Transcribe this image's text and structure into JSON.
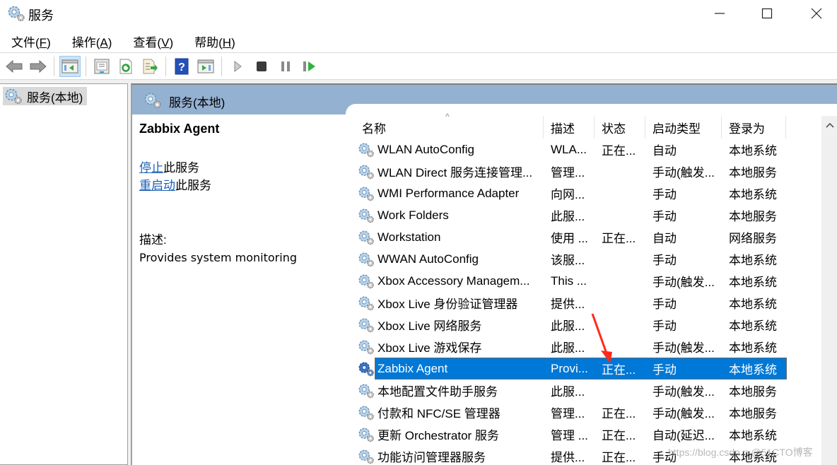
{
  "window": {
    "title": "服务",
    "minimize_icon": "minimize-icon",
    "maximize_icon": "maximize-icon",
    "close_icon": "close-icon"
  },
  "menu": [
    {
      "label": "文件(",
      "key": "F",
      "suffix": ")"
    },
    {
      "label": "操作(",
      "key": "A",
      "suffix": ")"
    },
    {
      "label": "查看(",
      "key": "V",
      "suffix": ")"
    },
    {
      "label": "帮助(",
      "key": "H",
      "suffix": ")"
    }
  ],
  "toolbar": {
    "buttons": [
      "back-icon",
      "forward-icon",
      "show-hide-console-tree-icon",
      "properties-icon",
      "refresh-icon",
      "export-list-icon",
      "help-icon",
      "show-hide-action-pane-icon",
      "start-service-icon",
      "stop-service-icon",
      "pause-service-icon",
      "resume-service-icon"
    ]
  },
  "tree": {
    "root_label": "服务(本地)"
  },
  "main": {
    "header_title": "服务(本地)",
    "selected_service": "Zabbix Agent",
    "actions": [
      {
        "link": "停止",
        "text": "此服务"
      },
      {
        "link": "重启动",
        "text": "此服务"
      }
    ],
    "description_label": "描述:",
    "description_text": "Provides system monitoring"
  },
  "list": {
    "columns": [
      "名称",
      "描述",
      "状态",
      "启动类型",
      "登录为"
    ],
    "sort_indicator": "^",
    "rows": [
      {
        "name": "WLAN AutoConfig",
        "desc": "WLA...",
        "state": "正在...",
        "start": "自动",
        "logon": "本地系统"
      },
      {
        "name": "WLAN Direct 服务连接管理...",
        "desc": "管理...",
        "state": "",
        "start": "手动(触发...",
        "logon": "本地服务"
      },
      {
        "name": "WMI Performance Adapter",
        "desc": "向网...",
        "state": "",
        "start": "手动",
        "logon": "本地系统"
      },
      {
        "name": "Work Folders",
        "desc": "此服...",
        "state": "",
        "start": "手动",
        "logon": "本地服务"
      },
      {
        "name": "Workstation",
        "desc": "使用 ...",
        "state": "正在...",
        "start": "自动",
        "logon": "网络服务"
      },
      {
        "name": "WWAN AutoConfig",
        "desc": "该服...",
        "state": "",
        "start": "手动",
        "logon": "本地系统"
      },
      {
        "name": "Xbox Accessory Managem...",
        "desc": "This ...",
        "state": "",
        "start": "手动(触发...",
        "logon": "本地系统"
      },
      {
        "name": "Xbox Live 身份验证管理器",
        "desc": "提供...",
        "state": "",
        "start": "手动",
        "logon": "本地系统"
      },
      {
        "name": "Xbox Live 网络服务",
        "desc": "此服...",
        "state": "",
        "start": "手动",
        "logon": "本地系统"
      },
      {
        "name": "Xbox Live 游戏保存",
        "desc": "此服...",
        "state": "",
        "start": "手动(触发...",
        "logon": "本地系统"
      },
      {
        "name": "Zabbix Agent",
        "desc": "Provi...",
        "state": "正在...",
        "start": "手动",
        "logon": "本地系统",
        "selected": true
      },
      {
        "name": "本地配置文件助手服务",
        "desc": "此服...",
        "state": "",
        "start": "手动(触发...",
        "logon": "本地服务"
      },
      {
        "name": "付款和 NFC/SE 管理器",
        "desc": "管理...",
        "state": "正在...",
        "start": "手动(触发...",
        "logon": "本地服务"
      },
      {
        "name": "更新 Orchestrator 服务",
        "desc": "管理 ...",
        "state": "正在...",
        "start": "自动(延迟...",
        "logon": "本地系统"
      },
      {
        "name": "功能访问管理器服务",
        "desc": "提供...",
        "state": "正在...",
        "start": "手动",
        "logon": "本地系统"
      }
    ]
  },
  "colors": {
    "selection": "#0078d7",
    "header_band": "#94b1d1",
    "link": "#1a5fb4",
    "annotation_arrow": "#ff2a1a"
  },
  "watermark": "https://blog.csdn.n @51CTO博客"
}
